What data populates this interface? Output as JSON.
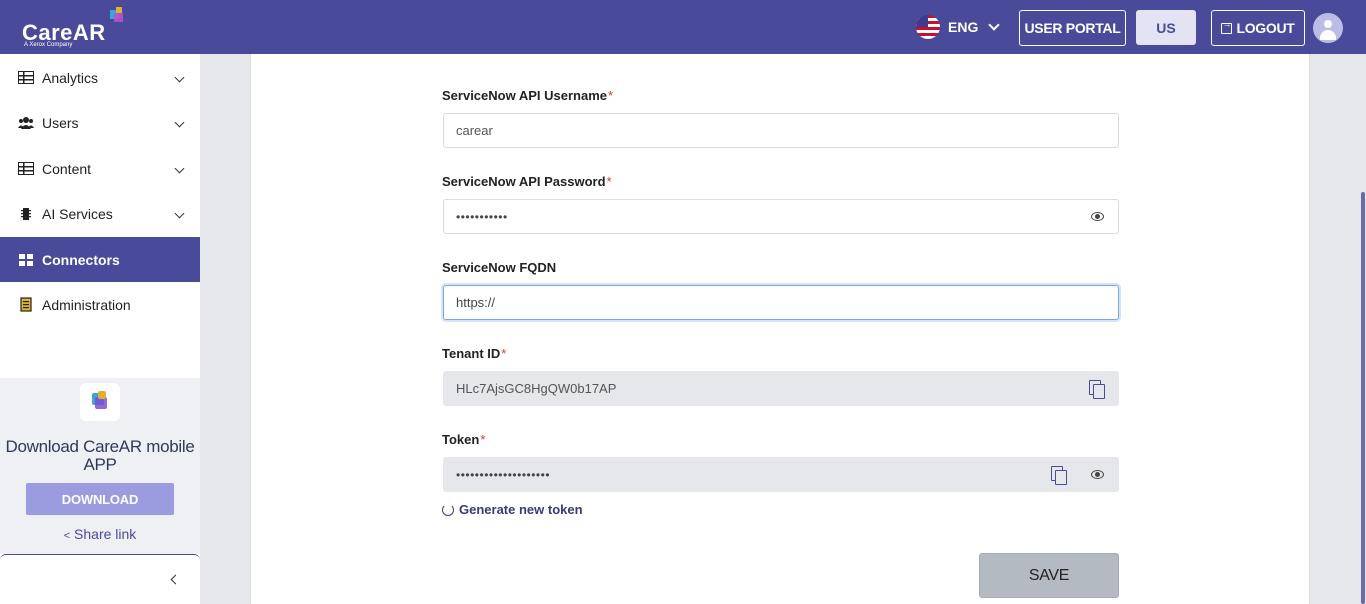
{
  "header": {
    "logo_text": "CareAR",
    "logo_tagline": "A Xerox Company",
    "language": "ENG",
    "user_portal_label": "USER PORTAL",
    "region_label": "US",
    "logout_label": "LOGOUT"
  },
  "sidebar": {
    "items": [
      {
        "label": "Analytics",
        "icon": "table-icon"
      },
      {
        "label": "Users",
        "icon": "users-icon"
      },
      {
        "label": "Content",
        "icon": "table-icon"
      },
      {
        "label": "AI Services",
        "icon": "chip-icon"
      },
      {
        "label": "Connectors",
        "icon": "grid-icon",
        "active": true
      },
      {
        "label": "Administration",
        "icon": "clipboard-icon"
      }
    ],
    "promo": {
      "title": "Download CareAR mobile APP",
      "download_label": "DOWNLOAD",
      "share_label": "Share link"
    }
  },
  "form": {
    "username": {
      "label": "ServiceNow API Username",
      "required": "*",
      "value": "carear"
    },
    "password": {
      "label": "ServiceNow API Password",
      "required": "*",
      "value": "•••••••••••"
    },
    "fqdn": {
      "label": "ServiceNow FQDN",
      "value": "https://"
    },
    "tenant": {
      "label": "Tenant ID",
      "required": "*",
      "value": "HLc7AjsGC8HgQW0b17AP"
    },
    "token": {
      "label": "Token",
      "required": "*",
      "value": "••••••••••••••••••••"
    },
    "generate_label": "Generate new token",
    "save_label": "SAVE"
  },
  "colors": {
    "brand": "#4a4a9b",
    "required": "#dd3333"
  }
}
